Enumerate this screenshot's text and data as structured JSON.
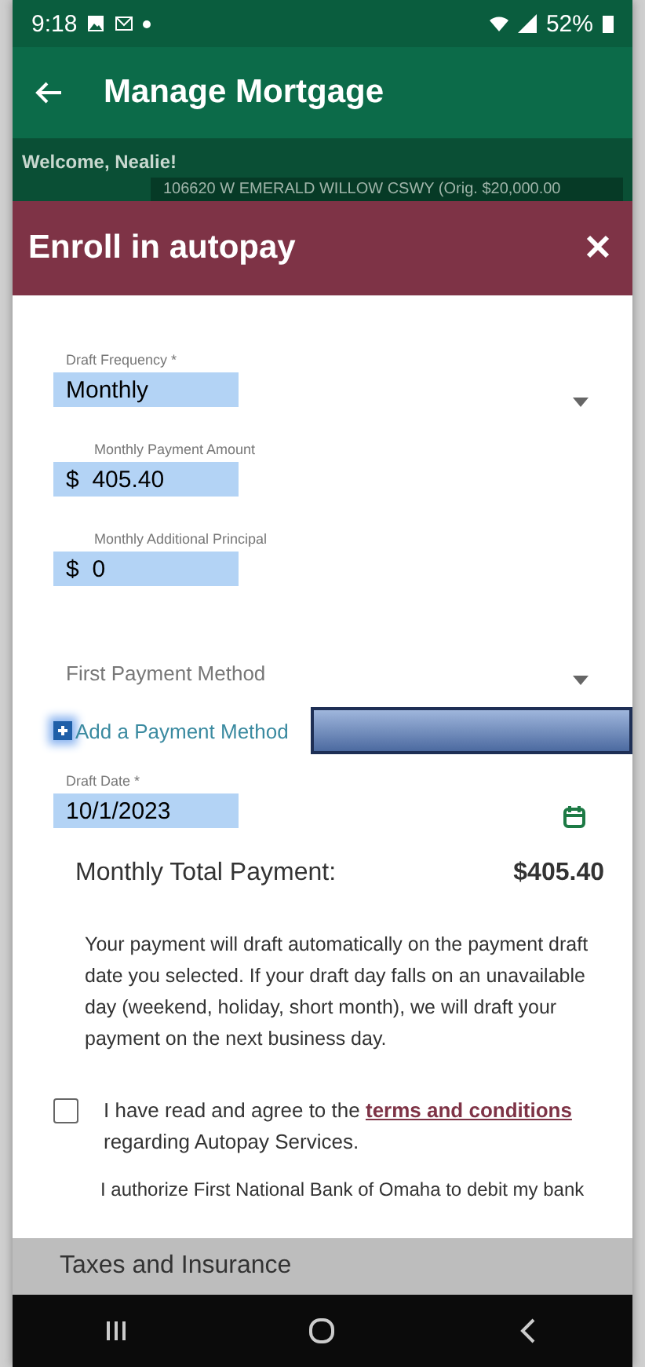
{
  "status_bar": {
    "time": "9:18",
    "battery": "52%"
  },
  "app_bar": {
    "title": "Manage Mortgage"
  },
  "welcome": {
    "greeting": "Welcome, Nealie!",
    "account": "106620 W EMERALD WILLOW CSWY (Orig. $20,000.00"
  },
  "dialog": {
    "title": "Enroll in autopay",
    "fields": [
      {
        "kind": "select",
        "label": "Draft Frequency *",
        "value": "Monthly"
      },
      {
        "kind": "money",
        "label": "Monthly Payment Amount",
        "prefix": "$",
        "value": "405.40"
      },
      {
        "kind": "money",
        "label": "Monthly Additional Principal",
        "prefix": "$",
        "value": "0"
      },
      {
        "kind": "select",
        "placeholder": "First Payment Method"
      }
    ],
    "add_payment_link": "Add a Payment Method",
    "draft_date": {
      "label": "Draft Date *",
      "value": "10/1/2023"
    },
    "total": {
      "label": "Monthly Total Payment:",
      "value": "$405.40"
    },
    "notice": "Your payment will draft automatically on the payment draft date you selected. If your draft day falls on an unavailable day (weekend, holiday, short month), we will draft your payment on the next business day.",
    "agreement": {
      "checked": false,
      "before": "I have read and agree to the",
      "link": "terms and conditions",
      "after": "regarding Autopay Services."
    },
    "authorization": "I authorize First National Bank of Omaha to debit my bank"
  },
  "bottom_section": "Taxes and Insurance"
}
